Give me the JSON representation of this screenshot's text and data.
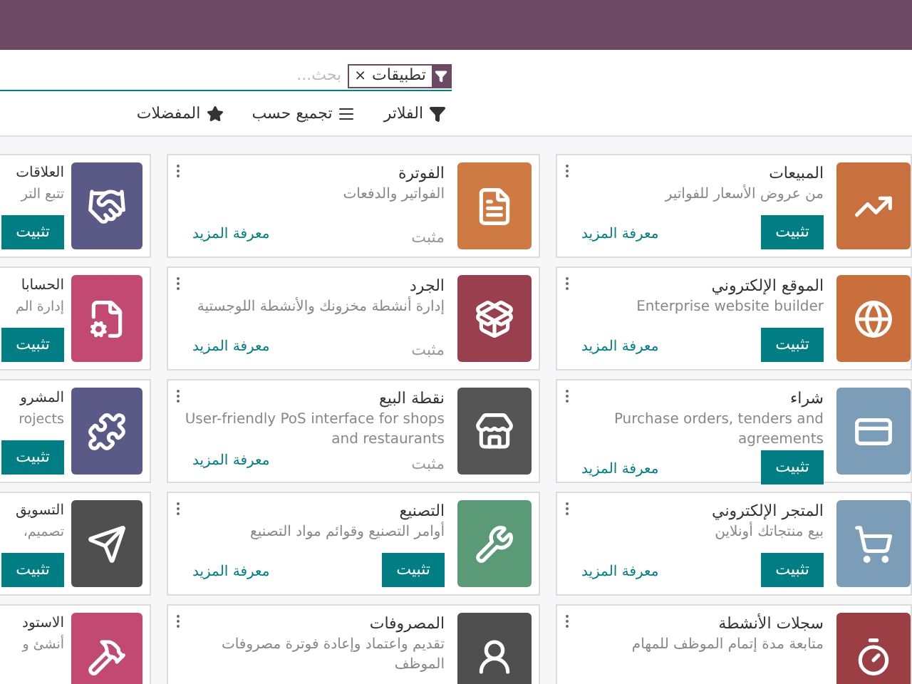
{
  "search": {
    "facet": {
      "label": "تطبيقات",
      "remove": "×"
    },
    "placeholder": "بحث..."
  },
  "toolbar": [
    {
      "kind": "filter",
      "label": "الفلاتر"
    },
    {
      "kind": "group",
      "label": "تجميع حسب"
    },
    {
      "kind": "favorite",
      "label": "المفضلات"
    }
  ],
  "apps": [
    {
      "title": "المبيعات",
      "description": "من عروض الأسعار للفواتير",
      "action": {
        "kind": "button",
        "label": "تثبيت"
      },
      "link": "معرفة المزيد"
    },
    {
      "title": "الفوترة",
      "description": "الفواتير والدفعات",
      "action": {
        "kind": "status",
        "label": "مثبت"
      },
      "link": "معرفة المزيد"
    },
    {
      "title": "العلاقات",
      "description": "تتبع التر",
      "action": {
        "kind": "button",
        "label": "تثبيت"
      }
    },
    {
      "title": "الموقع الإلكتروني",
      "description": "Enterprise website builder",
      "action": {
        "kind": "button",
        "label": "تثبيت"
      },
      "link": "معرفة المزيد"
    },
    {
      "title": "الجرد",
      "description": "إدارة أنشطة مخزونك والأنشطة اللوجستية",
      "action": {
        "kind": "status",
        "label": "مثبت"
      },
      "link": "معرفة المزيد"
    },
    {
      "title": "الحسابا",
      "description": "إدارة الم",
      "action": {
        "kind": "button",
        "label": "تثبيت"
      }
    },
    {
      "title": "شراء",
      "description": "Purchase orders, tenders and agreements",
      "action": {
        "kind": "button",
        "label": "تثبيت"
      },
      "link": "معرفة المزيد"
    },
    {
      "title": "نقطة البيع",
      "description": "User-friendly PoS interface for shops and restaurants",
      "action": {
        "kind": "status",
        "label": "مثبت"
      },
      "link": "معرفة المزيد"
    },
    {
      "title": "المشرو",
      "description": "rojects",
      "action": {
        "kind": "button",
        "label": "تثبيت"
      }
    },
    {
      "title": "المتجر الإلكتروني",
      "description": "بيع منتجاتك أونلاين",
      "action": {
        "kind": "button",
        "label": "تثبيت"
      },
      "link": "معرفة المزيد"
    },
    {
      "title": "التصنيع",
      "description": "أوامر التصنيع وقوائم مواد التصنيع",
      "action": {
        "kind": "button",
        "label": "تثبيت"
      },
      "link": "معرفة المزيد"
    },
    {
      "title": "التسويق",
      "description": "تصميم،",
      "action": {
        "kind": "button",
        "label": "تثبيت"
      }
    },
    {
      "title": "سجلات الأنشطة",
      "description": "متابعة مدة إتمام الموظف للمهام"
    },
    {
      "title": "المصروفات",
      "description": "تقديم واعتماد وإعادة فوترة مصروفات الموظف"
    },
    {
      "title": "الاستود",
      "description": "أنشئ و"
    }
  ]
}
